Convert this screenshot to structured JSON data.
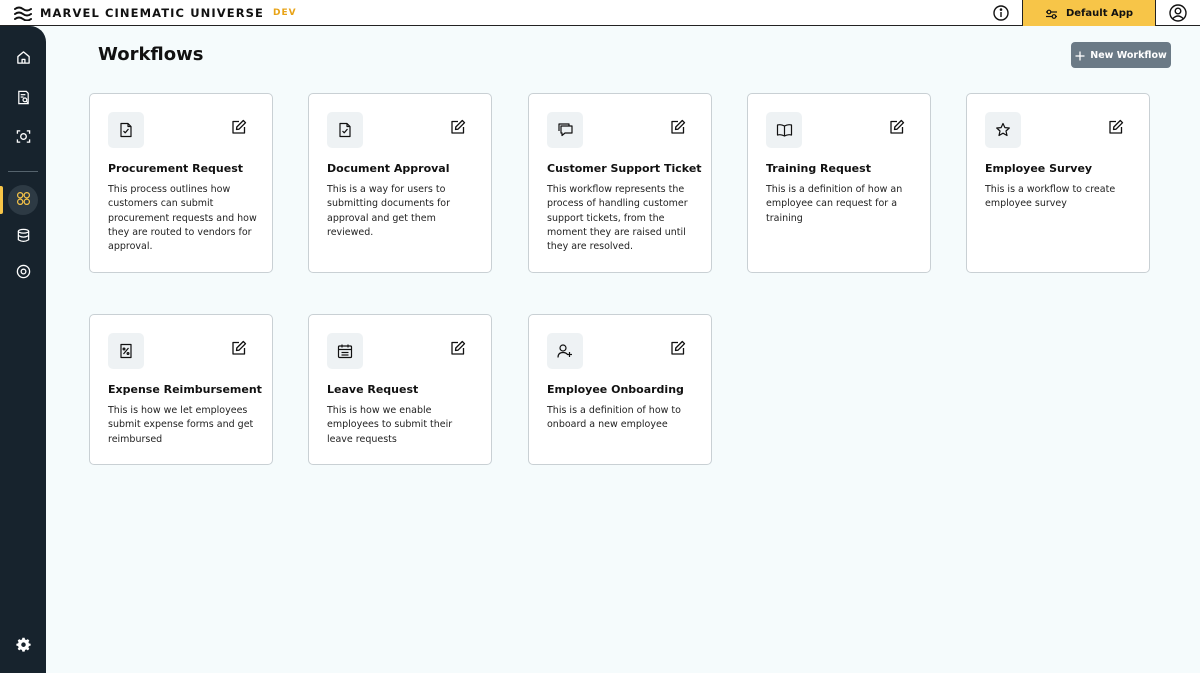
{
  "header": {
    "brand_name": "MARVEL CINEMATIC UNIVERSE",
    "env_badge": "DEV",
    "app_selector_label": "Default App",
    "logo_icon": "waves-logo-icon",
    "info_icon": "info-icon",
    "user_icon": "user-circle-icon"
  },
  "sidebar": {
    "items": [
      {
        "name": "home",
        "icon": "home-icon",
        "active": false
      },
      {
        "name": "documents-search",
        "icon": "document-search-icon",
        "active": false
      },
      {
        "name": "scan",
        "icon": "scan-icon",
        "active": false
      },
      {
        "name": "workflows",
        "icon": "workflows-icon",
        "active": true
      },
      {
        "name": "database",
        "icon": "database-icon",
        "active": false
      },
      {
        "name": "target",
        "icon": "target-icon",
        "active": false
      }
    ],
    "settings_icon": "gear-icon"
  },
  "main": {
    "title": "Workflows",
    "new_button_label": "New Workflow"
  },
  "workflows": [
    {
      "title": "Procurement Request",
      "description": "This process outlines how customers can submit procurement requests and how they are routed to vendors for approval.",
      "icon": "document-check-icon"
    },
    {
      "title": "Document Approval",
      "description": "This is a way for users to submitting documents for approval and get them reviewed.",
      "icon": "document-check-icon"
    },
    {
      "title": "Customer Support Ticket",
      "description": "This workflow represents the process of handling customer support tickets, from the moment they are raised until they are resolved.",
      "icon": "chat-bubbles-icon"
    },
    {
      "title": "Training Request",
      "description": "This is a definition of how an employee can request for a training",
      "icon": "book-icon"
    },
    {
      "title": "Employee Survey",
      "description": "This is a workflow to create employee survey",
      "icon": "star-icon"
    },
    {
      "title": "Expense Reimbursement",
      "description": "This is how we let employees submit expense forms and get reimbursed",
      "icon": "receipt-percent-icon"
    },
    {
      "title": "Leave Request",
      "description": "This is how we enable employees to submit their leave requests",
      "icon": "calendar-icon"
    },
    {
      "title": "Employee Onboarding",
      "description": "This is a definition of how to onboard a new employee",
      "icon": "user-add-icon"
    }
  ],
  "colors": {
    "accent": "#f7c548",
    "sidebar": "#17232d",
    "env_badge": "#e8a317",
    "button": "#6b7a86"
  }
}
